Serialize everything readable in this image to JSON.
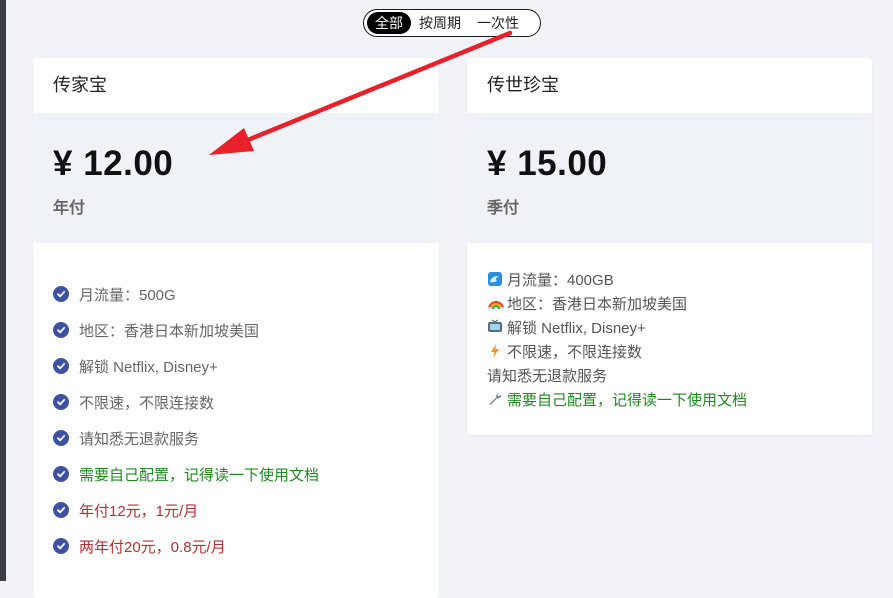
{
  "filter": {
    "tabs": [
      {
        "label": "全部",
        "active": true
      },
      {
        "label": "按周期",
        "active": false
      },
      {
        "label": "一次性",
        "active": false
      }
    ]
  },
  "plans": [
    {
      "name": "传家宝",
      "price": "¥ 12.00",
      "period": "年付",
      "features": [
        {
          "text": "月流量：500G",
          "color": "gray"
        },
        {
          "text": "地区：香港日本新加坡美国",
          "color": "gray"
        },
        {
          "text": "解锁 Netflix, Disney+",
          "color": "gray"
        },
        {
          "text": "不限速，不限连接数",
          "color": "gray"
        },
        {
          "text": "请知悉无退款服务",
          "color": "gray"
        },
        {
          "text": "需要自己配置，记得读一下使用文档",
          "color": "green"
        },
        {
          "text": "年付12元，1元/月",
          "color": "red"
        },
        {
          "text": "两年付20元，0.8元/月",
          "color": "red"
        }
      ]
    },
    {
      "name": "传世珍宝",
      "price": "¥ 15.00",
      "period": "季付",
      "description": [
        {
          "icon": "wave-icon",
          "text": "月流量：400GB"
        },
        {
          "icon": "rainbow-icon",
          "text": "地区：香港日本新加坡美国"
        },
        {
          "icon": "tv-icon",
          "text": "解锁 Netflix, Disney+"
        },
        {
          "icon": "lightning-icon",
          "text": "不限速，不限连接数"
        },
        {
          "icon": "",
          "text": "请知悉无退款服务"
        },
        {
          "icon": "wrench-icon",
          "text": "需要自己配置，记得读一下使用文档"
        }
      ]
    }
  ],
  "colors": {
    "check": "#3f51a3",
    "green": "#1f8a1f",
    "red": "#b33030",
    "arrow": "#e8202a"
  }
}
